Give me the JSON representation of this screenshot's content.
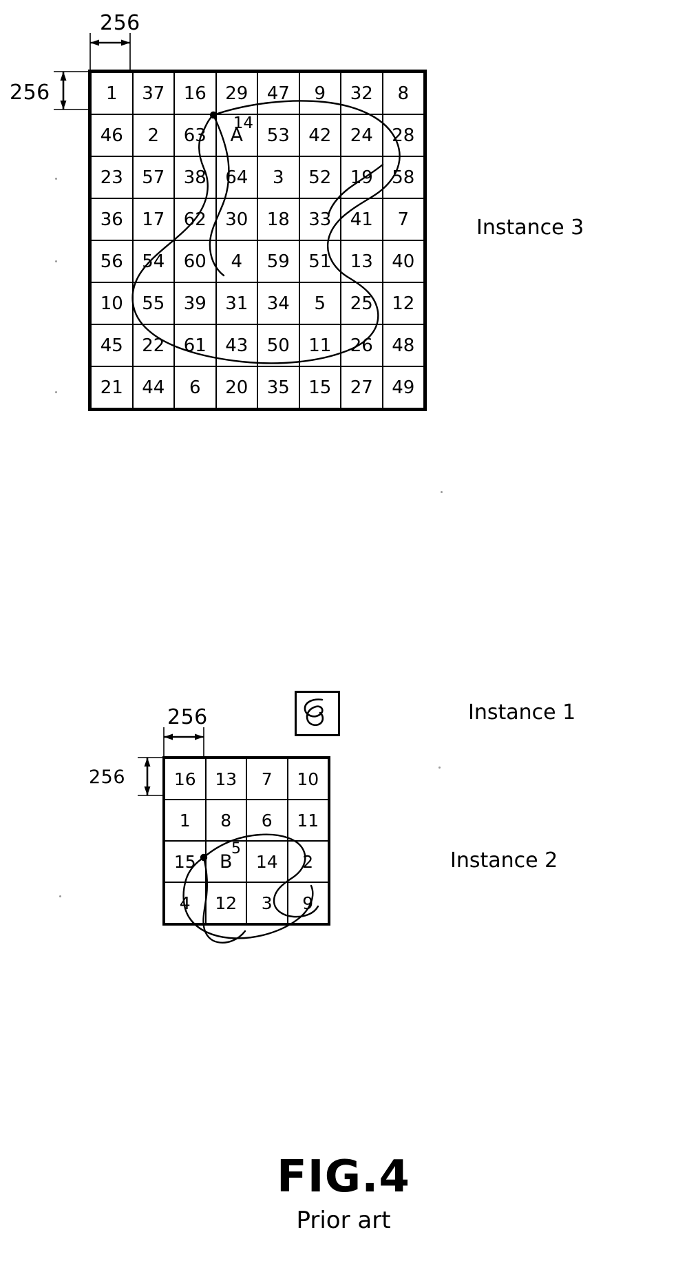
{
  "figure": {
    "number": "FIG.4",
    "caption": "Prior art"
  },
  "instance3": {
    "label": "Instance 3",
    "dim_width_label": "256",
    "dim_height_label": "256",
    "rows": 8,
    "cols": 8,
    "cells": [
      [
        "1",
        "37",
        "16",
        "29",
        "47",
        "9",
        "32",
        "8"
      ],
      [
        "46",
        "2",
        "63",
        "14",
        "53",
        "42",
        "24",
        "28"
      ],
      [
        "23",
        "57",
        "38",
        "64",
        "3",
        "52",
        "19",
        "58"
      ],
      [
        "36",
        "17",
        "62",
        "30",
        "18",
        "33",
        "41",
        "7"
      ],
      [
        "56",
        "54",
        "60",
        "4",
        "59",
        "51",
        "13",
        "40"
      ],
      [
        "10",
        "55",
        "39",
        "31",
        "34",
        "5",
        "25",
        "12"
      ],
      [
        "45",
        "22",
        "61",
        "43",
        "50",
        "11",
        "26",
        "48"
      ],
      [
        "21",
        "44",
        "6",
        "20",
        "35",
        "15",
        "27",
        "49"
      ]
    ],
    "macroblock": {
      "letter": "A",
      "number": "14",
      "row": 1,
      "col": 3
    }
  },
  "instance1": {
    "label": "Instance 1",
    "shape": "curve-glyph"
  },
  "instance2": {
    "label": "Instance 2",
    "dim_width_label": "256",
    "dim_height_label": "256",
    "rows": 4,
    "cols": 4,
    "cells": [
      [
        "16",
        "13",
        "7",
        "10"
      ],
      [
        "1",
        "8",
        "6",
        "11"
      ],
      [
        "15",
        "5",
        "14",
        "2"
      ],
      [
        "4",
        "12",
        "3",
        "9"
      ]
    ],
    "macroblock": {
      "letter": "B",
      "number": "5",
      "row": 2,
      "col": 1
    }
  },
  "colors": {
    "ink": "#000000",
    "paper": "#ffffff"
  }
}
